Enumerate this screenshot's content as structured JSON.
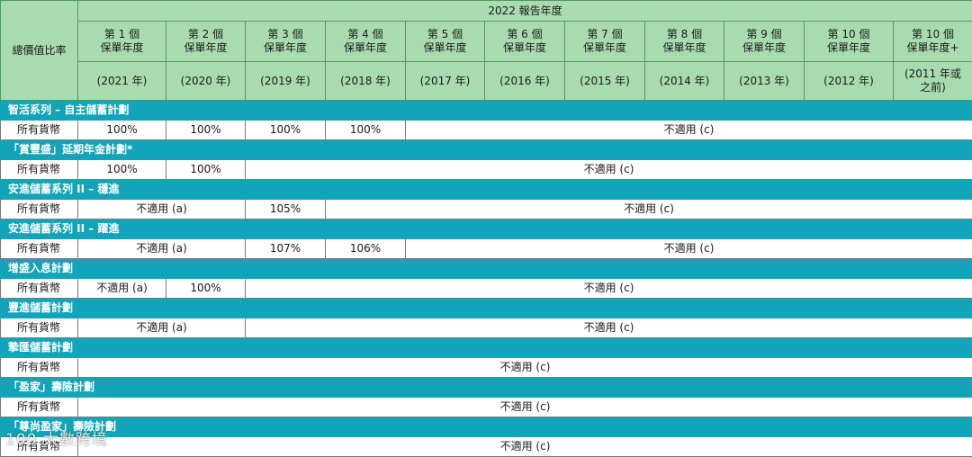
{
  "header": {
    "ratio_label": "總價值比率",
    "report_year": "2022 報告年度",
    "policy_years": [
      {
        "pos": "第 1 個\n保單年度",
        "year": "(2021 年)"
      },
      {
        "pos": "第 2 個\n保單年度",
        "year": "(2020 年)"
      },
      {
        "pos": "第 3 個\n保單年度",
        "year": "(2019 年)"
      },
      {
        "pos": "第 4 個\n保單年度",
        "year": "(2018 年)"
      },
      {
        "pos": "第 5 個\n保單年度",
        "year": "(2017 年)"
      },
      {
        "pos": "第 6 個\n保單年度",
        "year": "(2016 年)"
      },
      {
        "pos": "第 7 個\n保單年度",
        "year": "(2015 年)"
      },
      {
        "pos": "第 8 個\n保單年度",
        "year": "(2014 年)"
      },
      {
        "pos": "第 9 個\n保單年度",
        "year": "(2013 年)"
      },
      {
        "pos": "第 10 個\n保單年度",
        "year": "(2012 年)"
      },
      {
        "pos": "第 10 個\n保單年度+",
        "year": "(2011 年或\n之前)"
      }
    ]
  },
  "groups": [
    {
      "name": "智活系列 – 自主儲蓄計劃",
      "currency": "所有貨幣",
      "cells": [
        {
          "text": "100%",
          "span": 1
        },
        {
          "text": "100%",
          "span": 1
        },
        {
          "text": "100%",
          "span": 1
        },
        {
          "text": "100%",
          "span": 1
        },
        {
          "text": "不適用 (c)",
          "span": 7
        }
      ]
    },
    {
      "name": "「賞豐盛」延期年金計劃*",
      "currency": "所有貨幣",
      "cells": [
        {
          "text": "100%",
          "span": 1
        },
        {
          "text": "100%",
          "span": 1
        },
        {
          "text": "不適用 (c)",
          "span": 9
        }
      ]
    },
    {
      "name": "安進儲蓄系列 II – 穩進",
      "currency": "所有貨幣",
      "cells": [
        {
          "text": "不適用 (a)",
          "span": 2
        },
        {
          "text": "105%",
          "span": 1
        },
        {
          "text": "不適用 (c)",
          "span": 8
        }
      ]
    },
    {
      "name": "安進儲蓄系列 II – 躍進",
      "currency": "所有貨幣",
      "cells": [
        {
          "text": "不適用 (a)",
          "span": 2
        },
        {
          "text": "107%",
          "span": 1
        },
        {
          "text": "106%",
          "span": 1
        },
        {
          "text": "不適用 (c)",
          "span": 7
        }
      ]
    },
    {
      "name": "增盛入息計劃",
      "currency": "所有貨幣",
      "cells": [
        {
          "text": "不適用 (a)",
          "span": 1
        },
        {
          "text": "100%",
          "span": 1
        },
        {
          "text": "不適用 (c)",
          "span": 9
        }
      ]
    },
    {
      "name": "豐進儲蓄計劃",
      "currency": "所有貨幣",
      "cells": [
        {
          "text": "不適用 (a)",
          "span": 2
        },
        {
          "text": "不適用 (c)",
          "span": 9
        }
      ]
    },
    {
      "name": "摯匯儲蓄計劃",
      "currency": "所有貨幣",
      "cells": [
        {
          "text": "不適用 (c)",
          "span": 11
        }
      ]
    },
    {
      "name": "「盈家」壽險計劃",
      "currency": "所有貨幣",
      "cells": [
        {
          "text": "不適用 (c)",
          "span": 11
        }
      ]
    },
    {
      "name": "「尊尚盈家」壽險計劃",
      "currency": "所有貨幣",
      "cells": [
        {
          "text": "不適用 (c)",
          "span": 11
        }
      ]
    }
  ],
  "watermark": "100 大數跨境"
}
